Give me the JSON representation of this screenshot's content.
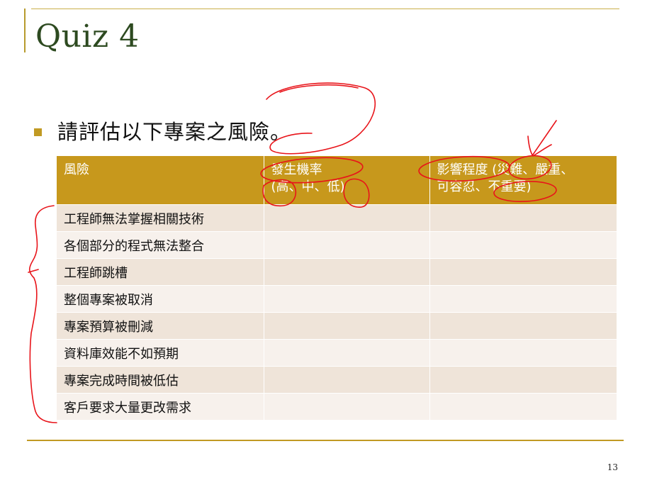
{
  "slide": {
    "title": "Quiz 4",
    "bullet": "請評估以下專案之風險。",
    "page_number": "13"
  },
  "table": {
    "headers": [
      {
        "line1": "風險",
        "line2": ""
      },
      {
        "line1": "發生機率",
        "line2": "(高、中、低)"
      },
      {
        "line1": "影響程度 (災難、嚴重、",
        "line2": "可容忍、不重要)"
      }
    ],
    "rows": [
      [
        "工程師無法掌握相關技術",
        "",
        ""
      ],
      [
        "各個部分的程式無法整合",
        "",
        ""
      ],
      [
        "工程師跳槽",
        "",
        ""
      ],
      [
        "整個專案被取消",
        "",
        ""
      ],
      [
        "專案預算被刪減",
        "",
        ""
      ],
      [
        "資料庫效能不如預期",
        "",
        ""
      ],
      [
        "專案完成時間被低估",
        "",
        ""
      ],
      [
        "客戶要求大量更改需求",
        "",
        ""
      ]
    ]
  },
  "colors": {
    "header_bg": "#c7981c",
    "accent": "#c19a23",
    "title": "#2d4a20",
    "annotation_ink": "#e8141a",
    "row_odd": "#efe4d9",
    "row_even": "#f7f1ec"
  }
}
